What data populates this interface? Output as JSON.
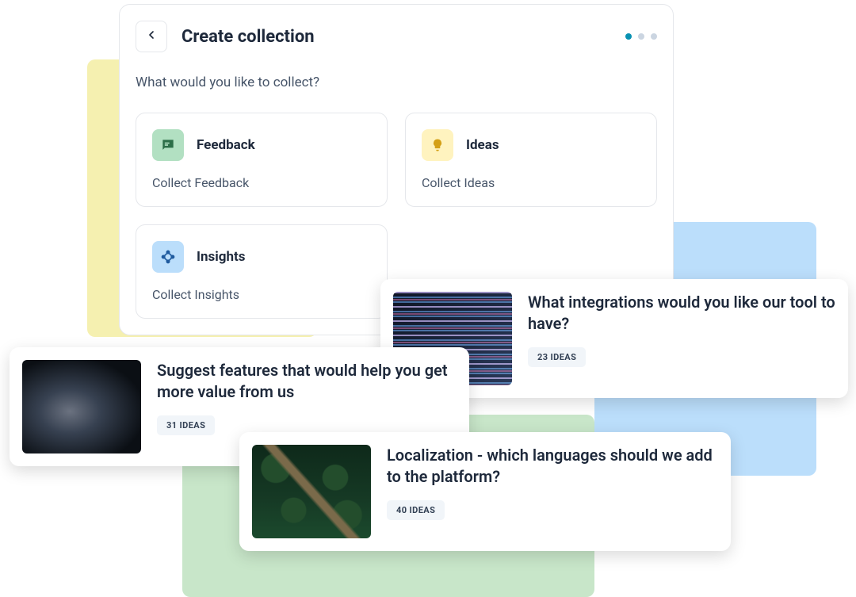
{
  "header": {
    "title": "Create collection",
    "prompt": "What would you like to collect?"
  },
  "options": [
    {
      "title": "Feedback",
      "desc": "Collect Feedback"
    },
    {
      "title": "Ideas",
      "desc": "Collect Ideas"
    },
    {
      "title": "Insights",
      "desc": "Collect Insights"
    }
  ],
  "idea_cards": [
    {
      "title": "Suggest features that would help you get more value from us",
      "badge": "31 IDEAS"
    },
    {
      "title": "What integrations would you like our tool to have?",
      "badge": "23 IDEAS"
    },
    {
      "title": "Localization - which languages should we add to the platform?",
      "badge": "40 IDEAS"
    }
  ]
}
